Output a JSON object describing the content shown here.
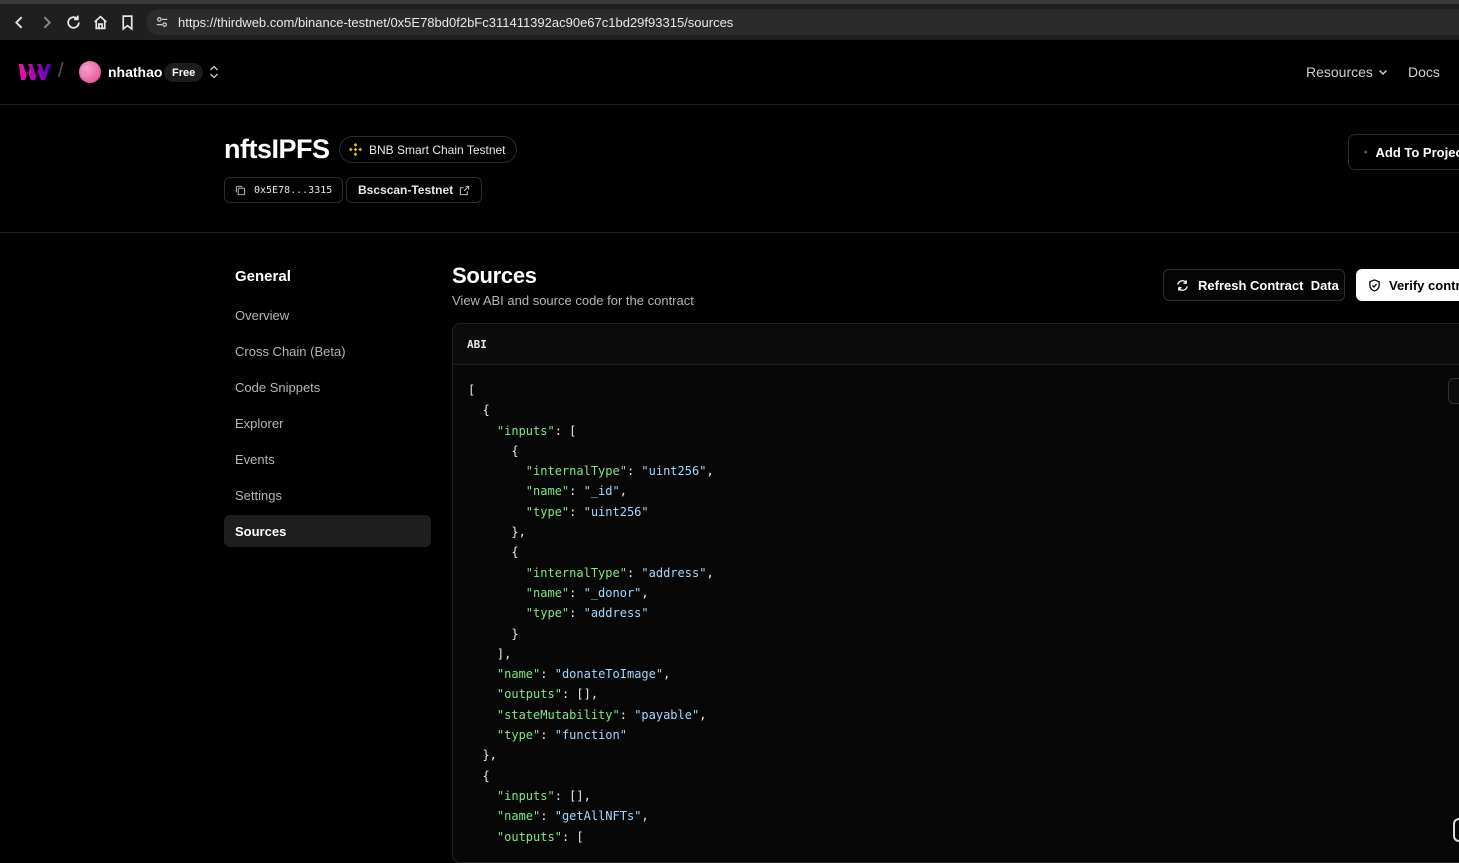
{
  "browser": {
    "url": "https://thirdweb.com/binance-testnet/0x5E78bd0f2bFc311411392ac90e67c1bd29f93315/sources"
  },
  "header": {
    "username": "nhathao",
    "plan": "Free",
    "nav": {
      "resources": "Resources",
      "docs": "Docs"
    }
  },
  "contract": {
    "name": "nftsIPFS",
    "chain": "BNB Smart Chain Testnet",
    "address_short": "0x5E78...3315",
    "explorer": "Bscscan-Testnet",
    "add_to_project": "Add To Project"
  },
  "sidebar": {
    "title": "General",
    "items": [
      {
        "label": "Overview",
        "active": false
      },
      {
        "label": "Cross Chain (Beta)",
        "active": false
      },
      {
        "label": "Code Snippets",
        "active": false
      },
      {
        "label": "Explorer",
        "active": false
      },
      {
        "label": "Events",
        "active": false
      },
      {
        "label": "Settings",
        "active": false
      },
      {
        "label": "Sources",
        "active": true
      }
    ]
  },
  "main": {
    "title": "Sources",
    "subtitle": "View ABI and source code for the contract",
    "refresh_label": "Refresh Contract  Data",
    "verify_label": "Verify contract",
    "abi_tab": "ABI",
    "code_lines": [
      [
        [
          "p",
          "["
        ]
      ],
      [
        [
          "p",
          "  {"
        ]
      ],
      [
        [
          "p",
          "    "
        ],
        [
          "k",
          "\"inputs\""
        ],
        [
          "p",
          ": ["
        ]
      ],
      [
        [
          "p",
          "      {"
        ]
      ],
      [
        [
          "p",
          "        "
        ],
        [
          "k",
          "\"internalType\""
        ],
        [
          "p",
          ": "
        ],
        [
          "s",
          "\"uint256\""
        ],
        [
          "p",
          ","
        ]
      ],
      [
        [
          "p",
          "        "
        ],
        [
          "k",
          "\"name\""
        ],
        [
          "p",
          ": "
        ],
        [
          "s",
          "\"_id\""
        ],
        [
          "p",
          ","
        ]
      ],
      [
        [
          "p",
          "        "
        ],
        [
          "k",
          "\"type\""
        ],
        [
          "p",
          ": "
        ],
        [
          "s",
          "\"uint256\""
        ]
      ],
      [
        [
          "p",
          "      },"
        ]
      ],
      [
        [
          "p",
          "      {"
        ]
      ],
      [
        [
          "p",
          "        "
        ],
        [
          "k",
          "\"internalType\""
        ],
        [
          "p",
          ": "
        ],
        [
          "s",
          "\"address\""
        ],
        [
          "p",
          ","
        ]
      ],
      [
        [
          "p",
          "        "
        ],
        [
          "k",
          "\"name\""
        ],
        [
          "p",
          ": "
        ],
        [
          "s",
          "\"_donor\""
        ],
        [
          "p",
          ","
        ]
      ],
      [
        [
          "p",
          "        "
        ],
        [
          "k",
          "\"type\""
        ],
        [
          "p",
          ": "
        ],
        [
          "s",
          "\"address\""
        ]
      ],
      [
        [
          "p",
          "      }"
        ]
      ],
      [
        [
          "p",
          "    ],"
        ]
      ],
      [
        [
          "p",
          "    "
        ],
        [
          "k",
          "\"name\""
        ],
        [
          "p",
          ": "
        ],
        [
          "s",
          "\"donateToImage\""
        ],
        [
          "p",
          ","
        ]
      ],
      [
        [
          "p",
          "    "
        ],
        [
          "k",
          "\"outputs\""
        ],
        [
          "p",
          ": [],"
        ]
      ],
      [
        [
          "p",
          "    "
        ],
        [
          "k",
          "\"stateMutability\""
        ],
        [
          "p",
          ": "
        ],
        [
          "s",
          "\"payable\""
        ],
        [
          "p",
          ","
        ]
      ],
      [
        [
          "p",
          "    "
        ],
        [
          "k",
          "\"type\""
        ],
        [
          "p",
          ": "
        ],
        [
          "s",
          "\"function\""
        ]
      ],
      [
        [
          "p",
          "  },"
        ]
      ],
      [
        [
          "p",
          "  {"
        ]
      ],
      [
        [
          "p",
          "    "
        ],
        [
          "k",
          "\"inputs\""
        ],
        [
          "p",
          ": [],"
        ]
      ],
      [
        [
          "p",
          "    "
        ],
        [
          "k",
          "\"name\""
        ],
        [
          "p",
          ": "
        ],
        [
          "s",
          "\"getAllNFTs\""
        ],
        [
          "p",
          ","
        ]
      ],
      [
        [
          "p",
          "    "
        ],
        [
          "k",
          "\"outputs\""
        ],
        [
          "p",
          ": ["
        ]
      ]
    ]
  }
}
